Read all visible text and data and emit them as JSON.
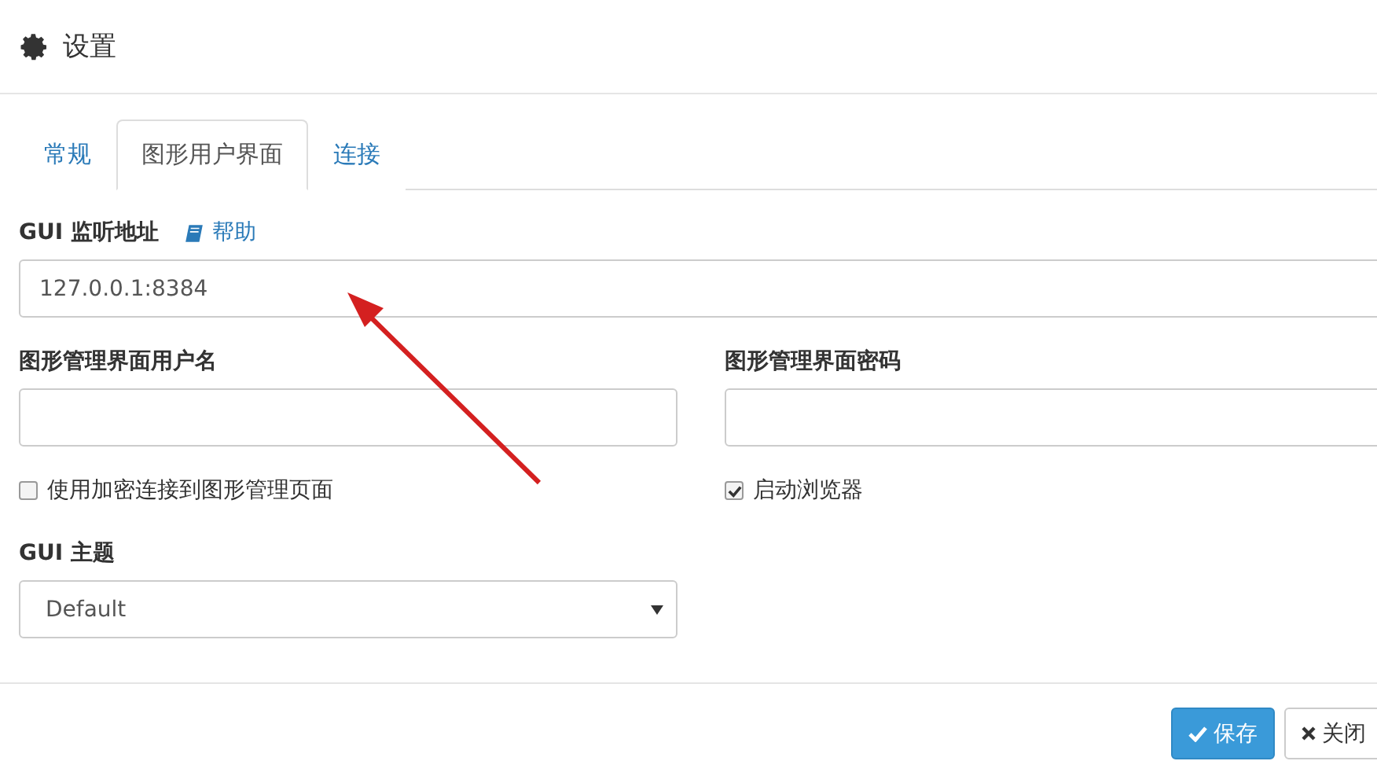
{
  "dialog": {
    "title": "设置"
  },
  "tabs": [
    {
      "label": "常规",
      "selected": false
    },
    {
      "label": "图形用户界面",
      "selected": true
    },
    {
      "label": "连接",
      "selected": false
    }
  ],
  "gui_address": {
    "label": "GUI 监听地址",
    "help_link": "帮助",
    "value": "127.0.0.1:8384"
  },
  "username": {
    "label": "图形管理界面用户名"
  },
  "password": {
    "label": "图形管理界面密码"
  },
  "checkboxes": [
    {
      "label": "使用加密连接到图形管理页面",
      "checked": false
    },
    {
      "label": "启动浏览器",
      "checked": true
    }
  ],
  "theme": {
    "label": "GUI 主题",
    "value": "Default"
  },
  "buttons": [
    {
      "label": "保存",
      "kind": "primary"
    },
    {
      "label": "关闭",
      "kind": "default"
    }
  ]
}
